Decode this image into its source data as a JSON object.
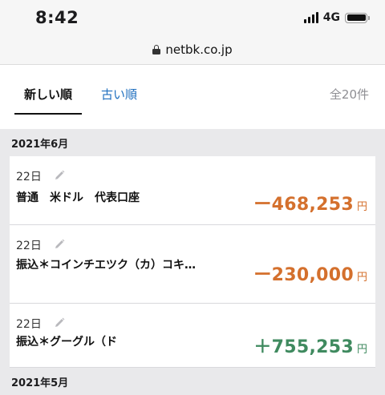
{
  "status": {
    "time": "8:42",
    "network": "4G"
  },
  "browser": {
    "url": "netbk.co.jp"
  },
  "tabs": {
    "newest": "新しい順",
    "oldest": "古い順",
    "total": "全20件"
  },
  "months": [
    {
      "label": "2021年6月",
      "transactions": [
        {
          "day": "22日",
          "name": "普通　米ドル　代表口座",
          "amount": "ー468,253",
          "yen": "円",
          "direction": "out"
        },
        {
          "day": "22日",
          "name": "振込＊コインチエツク（カ）コキ…",
          "amount": "ー230,000",
          "yen": "円",
          "direction": "out"
        },
        {
          "day": "22日",
          "name": "振込＊グーグル（ド",
          "amount": "＋755,253",
          "yen": "円",
          "direction": "in"
        }
      ]
    },
    {
      "label": "2021年5月"
    }
  ],
  "colors": {
    "outgoing": "#d4702d",
    "incoming": "#3f8a5f",
    "link": "#1f6fbf"
  },
  "icons": {
    "edit": "pencil-icon",
    "lock": "lock-icon"
  }
}
